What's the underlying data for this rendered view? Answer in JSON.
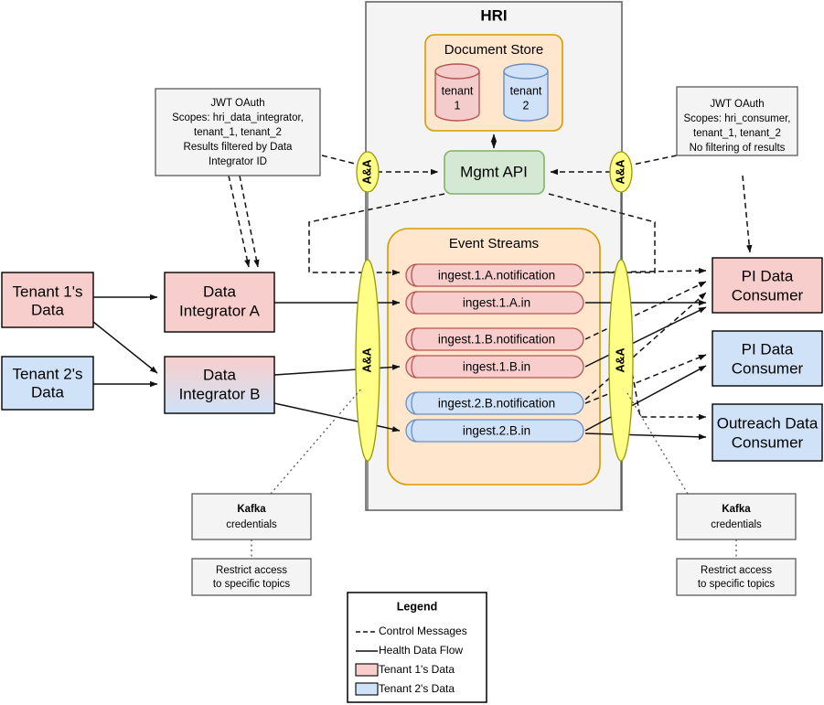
{
  "diagram": {
    "title": "HRI"
  },
  "hri": {
    "label": "HRI",
    "document_store": {
      "label": "Document Store",
      "databases": [
        {
          "line1": "tenant",
          "line2": "1",
          "color": "#f5cccc",
          "tenant": "1"
        },
        {
          "line1": "tenant",
          "line2": "2",
          "color": "#cfe2f7",
          "tenant": "2"
        }
      ]
    },
    "mgmt_api": {
      "label": "Mgmt API",
      "color": "#d5e8d4"
    },
    "event_streams": {
      "label": "Event Streams",
      "color": "#ffe6cc",
      "topics": [
        {
          "name": "ingest.1.A.notification",
          "color": "#f8cecc",
          "tenant": "1"
        },
        {
          "name": "ingest.1.A.in",
          "color": "#f8cecc",
          "tenant": "1"
        },
        {
          "name": "ingest.1.B.notification",
          "color": "#f8cecc",
          "tenant": "1"
        },
        {
          "name": "ingest.1.B.in",
          "color": "#f8cecc",
          "tenant": "1"
        },
        {
          "name": "ingest.2.B.notification",
          "color": "#cfe2f7",
          "tenant": "2"
        },
        {
          "name": "ingest.2.B.in",
          "color": "#cfe2f7",
          "tenant": "2"
        }
      ]
    }
  },
  "aa_gates": [
    {
      "id": "aa-mgmt-left",
      "label": "A&A"
    },
    {
      "id": "aa-mgmt-right",
      "label": "A&A"
    },
    {
      "id": "aa-streams-left",
      "label": "A&A"
    },
    {
      "id": "aa-streams-right",
      "label": "A&A"
    }
  ],
  "sources": [
    {
      "line1": "Tenant 1's",
      "line2": "Data",
      "color": "#f8cecc"
    },
    {
      "line1": "Tenant 2's",
      "line2": "Data",
      "color": "#cfe2f7"
    }
  ],
  "integrators": [
    {
      "line1": "Data",
      "line2": "Integrator A",
      "color": "#f8cecc"
    },
    {
      "line1": "Data",
      "line2": "Integrator B",
      "color": "gradient"
    }
  ],
  "consumers": [
    {
      "line1": "PI Data",
      "line2": "Consumer",
      "color": "#f8cecc"
    },
    {
      "line1": "PI Data",
      "line2": "Consumer",
      "color": "#cfe2f7"
    },
    {
      "line1": "Outreach Data",
      "line2": "Consumer",
      "color": "#cfe2f7"
    }
  ],
  "notes": {
    "left_oauth": {
      "lines": [
        "JWT OAuth",
        "Scopes: hri_data_integrator,",
        "tenant_1, tenant_2",
        "Results filtered by Data",
        "Integrator ID"
      ]
    },
    "right_oauth": {
      "lines": [
        "JWT OAuth",
        "Scopes: hri_consumer,",
        "tenant_1, tenant_2",
        "No filtering of results"
      ]
    },
    "left_kafka": {
      "title": "Kafka",
      "subtitle": "credentials"
    },
    "right_kafka": {
      "title": "Kafka",
      "subtitle": "credentials"
    },
    "left_restrict": {
      "line1": "Restrict access",
      "line2": "to specific topics"
    },
    "right_restrict": {
      "line1": "Restrict access",
      "line2": "to specific topics"
    }
  },
  "legend": {
    "title": "Legend",
    "items": [
      {
        "label": "Control Messages",
        "type": "dashed",
        "color": "#111111"
      },
      {
        "label": "Health Data Flow",
        "type": "solid",
        "color": "#111111"
      },
      {
        "label": "Tenant 1's Data",
        "type": "swatch",
        "color": "#f8cecc"
      },
      {
        "label": "Tenant 2's Data",
        "type": "swatch",
        "color": "#cfe2f7"
      }
    ]
  }
}
